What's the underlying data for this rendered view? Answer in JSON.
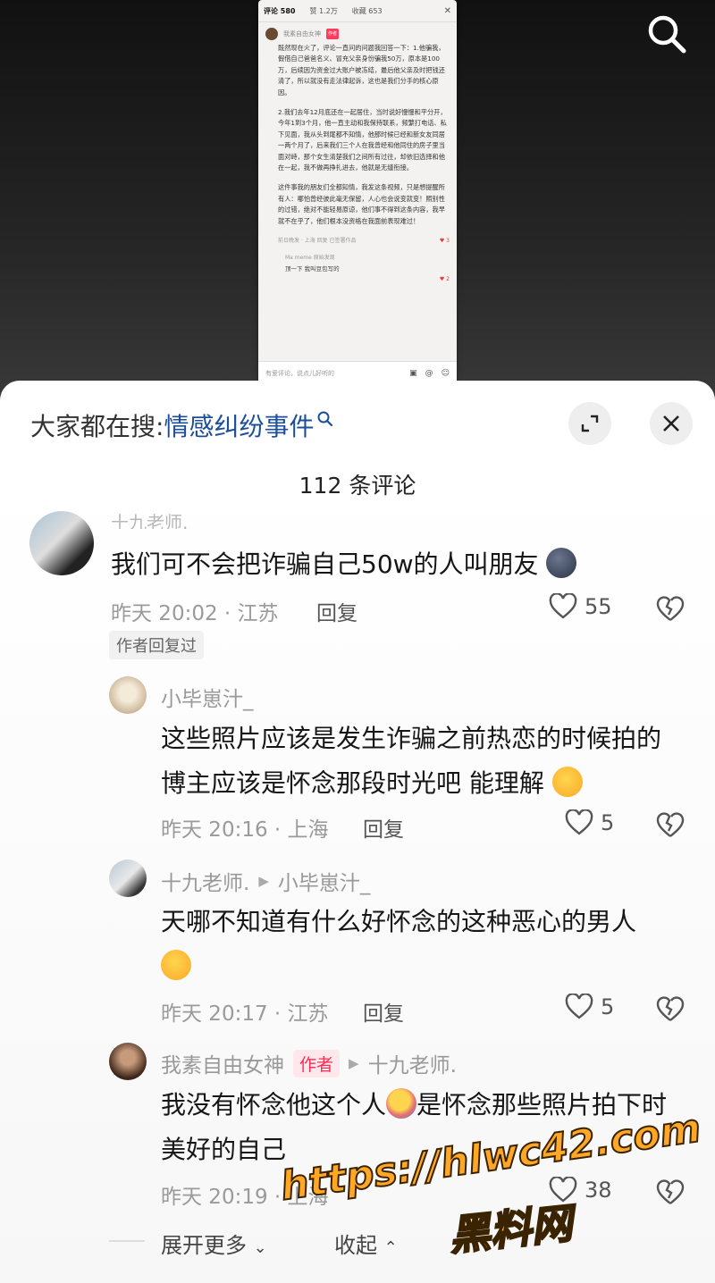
{
  "screenshot": {
    "tabs": [
      "评论 580",
      "赞 1.2万",
      "收藏 653"
    ],
    "user_name": "我素自由女神",
    "author_tag": "作者",
    "paragraphs": [
      "既然现在火了，评论一直问的问题我回答一下：1.他骗我，假借自己爸爸名义、冒充父亲身份骗我50万，原本是100万，后续因为资金过大账户被冻结，最后他父亲及时把钱还清了，所以就没有走法律起诉，这也是我们分手的核心原因。",
      "2.我们去年12月底还在一起居住，当时说好慢慢和平分开，今年1到3个月，他一直主动和我保持联系，频繁打电话、私下见面，我从头到尾都不知情，他那时候已经和新女友同居一两个月了，后来我们三个人在我曾经和他同住的房子里当面对峙，那个女生清楚我们之间所有过往，却依旧选择和他在一起，我不做再挣扎进去，他就是无缝衔接。",
      "这件事我的朋友们全都知情，我发这条视频，只是想提醒所有人：哪怕曾经彼此毫无保留，人心也会说变就变！照别性的过错，绝对不能轻易原谅，他们事不得到这条内容，我早就不在乎了，他们根本没资格在我面前表现难过！"
    ],
    "meta": "前日晚发 · 上海    回复    已签署作品",
    "likes": "3",
    "sub_user": "Ma meme   原始发现",
    "sub_text": "顶一下 我叫豆包写的",
    "sub_likes": "2",
    "input_placeholder": "有爱评论，说点儿好听的"
  },
  "sheet": {
    "suggest_label": "大家都在搜:",
    "suggest_keyword": "情感纠纷事件",
    "count_label": "112 条评论"
  },
  "comments": [
    {
      "name": "十九老师.",
      "text": "我们可不会把诈骗自己50w的人叫朋友",
      "meta": "昨天 20:02 · 江苏",
      "reply": "回复",
      "likes": "55",
      "pill": "作者回复过"
    },
    {
      "name": "小毕崽汁_",
      "text": "这些照片应该是发生诈骗之前热恋的时候拍的 博主应该是怀念那段时光吧 能理解",
      "meta": "昨天 20:16 · 上海",
      "reply": "回复",
      "likes": "5"
    },
    {
      "name": "十九老师.",
      "reply_to": "小毕崽汁_",
      "text": "天哪不知道有什么好怀念的这种恶心的男人",
      "meta": "昨天 20:17 · 江苏",
      "reply": "回复",
      "likes": "5"
    },
    {
      "name": "我素自由女神",
      "tag": "作者",
      "reply_to": "十九老师.",
      "text_a": "我没有怀念他这个人",
      "text_b": "是怀念那些照片拍下时美好的自己",
      "meta": "昨天 20:19 · 上海",
      "reply": "回复",
      "likes": "38"
    }
  ],
  "footer": {
    "expand": "展开更多",
    "collapse": "收起"
  },
  "watermark": {
    "url": "https://hlwc42.com",
    "site": "黑料网"
  },
  "colors": {
    "accent": "#fe2c55",
    "keyword": "#1c4f9a",
    "watermark": "#ffa726"
  }
}
